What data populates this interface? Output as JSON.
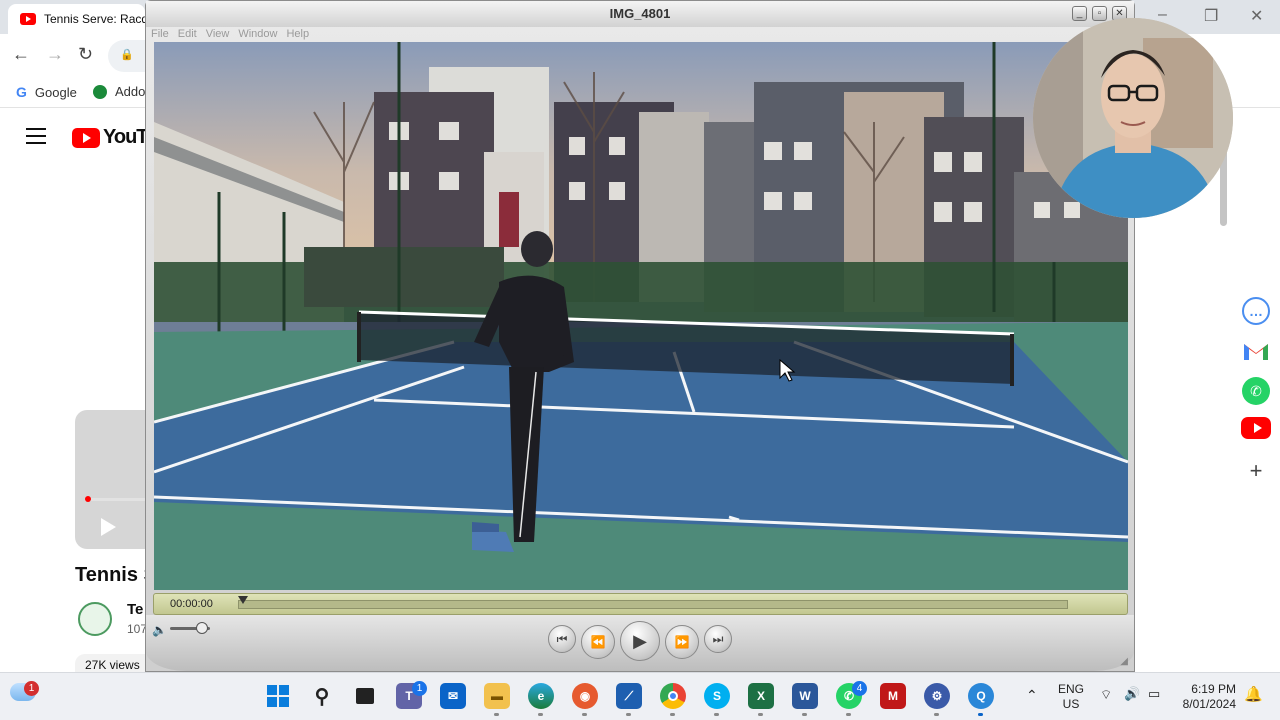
{
  "browser": {
    "tab_title": "Tennis Serve: Racqu",
    "bookmarks": [
      "Google",
      "Addo"
    ]
  },
  "youtube": {
    "logo_text": "YouTu",
    "video_title": "Tennis S",
    "channel_name": "Te",
    "channel_subs": "107",
    "views_text": "27K views"
  },
  "quicktime": {
    "window_title": "IMG_4801",
    "menu": [
      "File",
      "Edit",
      "View",
      "Window",
      "Help"
    ],
    "current_time": "00:00:00",
    "progress": 0.0,
    "volume": 0.8
  },
  "taskbar": {
    "teams_badge": "1",
    "whatsapp_badge": "4",
    "weather_badge": "1",
    "lang_line1": "ENG",
    "lang_line2": "US",
    "time": "6:19 PM",
    "date": "8/01/2024"
  },
  "colors": {
    "court_blue": "#3a6a9c",
    "court_green": "#4f8a7a",
    "youtube_red": "#ff0000",
    "timeline_bg": "#d3d7a4"
  },
  "icons": [
    "tennis-serve-video",
    "webcam-overlay",
    "copilot-icon",
    "gmail-icon",
    "whatsapp-icon",
    "youtube-icon",
    "plus-icon"
  ]
}
